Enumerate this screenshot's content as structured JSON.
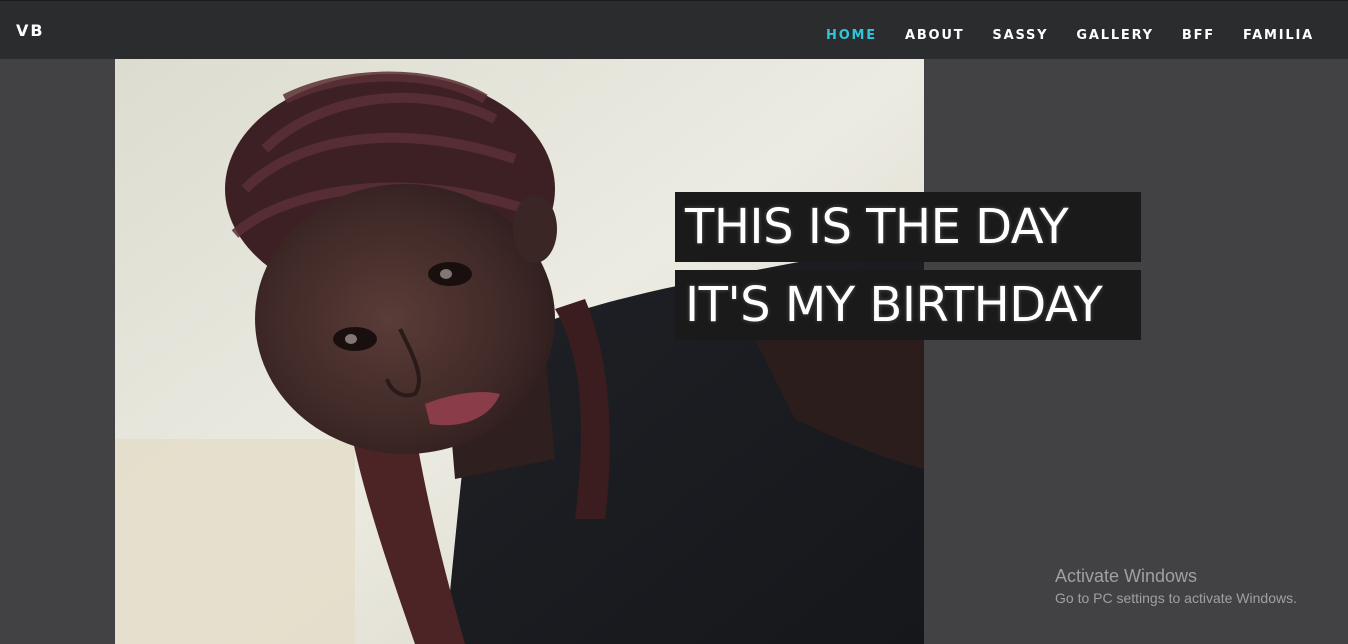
{
  "brand": "VB",
  "nav": {
    "items": [
      {
        "label": "HOME",
        "active": true
      },
      {
        "label": "ABOUT",
        "active": false
      },
      {
        "label": "SASSY",
        "active": false
      },
      {
        "label": "GALLERY",
        "active": false
      },
      {
        "label": "BFF",
        "active": false
      },
      {
        "label": "FAMILIA",
        "active": false
      }
    ],
    "active_color": "#2fc6d8"
  },
  "hero": {
    "caption_line_1": "THIS IS THE DAY",
    "caption_line_2": "IT'S MY BIRTHDAY"
  },
  "watermark": {
    "title": "Activate Windows",
    "subtitle": "Go to PC settings to activate Windows."
  },
  "colors": {
    "page_bg": "#424244",
    "navbar_bg": "#2b2c2e",
    "caption_bg": "#1a1a1a"
  }
}
